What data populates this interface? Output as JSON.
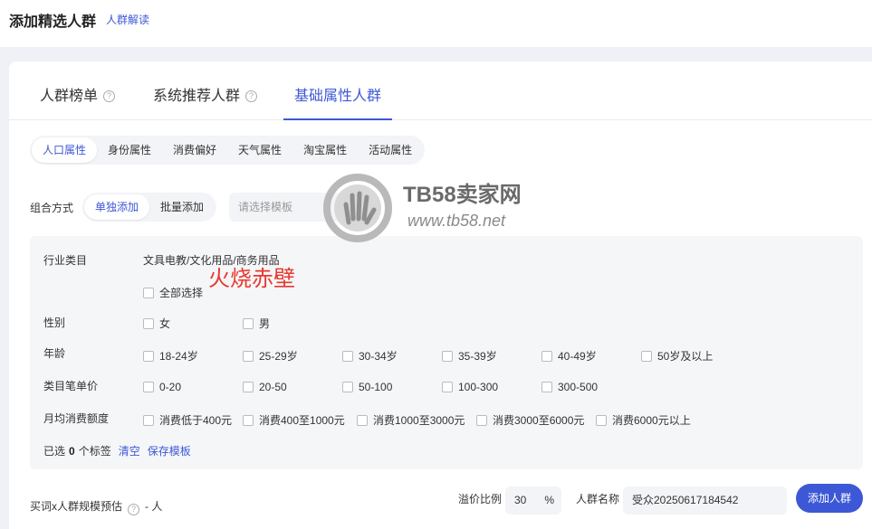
{
  "header": {
    "title": "添加精选人群",
    "link": "人群解读"
  },
  "tabs": [
    {
      "label": "人群榜单",
      "help": "?"
    },
    {
      "label": "系统推荐人群",
      "help": "?"
    },
    {
      "label": "基础属性人群"
    }
  ],
  "subtabs": [
    "人口属性",
    "身份属性",
    "消费偏好",
    "天气属性",
    "淘宝属性",
    "活动属性"
  ],
  "combo": {
    "label": "组合方式",
    "options": [
      "单独添加",
      "批量添加"
    ],
    "template_placeholder": "请选择模板"
  },
  "filters": {
    "industry_label": "行业类目",
    "industry_value": "文具电教/文化用品/商务用品",
    "select_all": "全部选择",
    "gender_label": "性别",
    "gender": [
      "女",
      "男"
    ],
    "age_label": "年龄",
    "ages": [
      "18-24岁",
      "25-29岁",
      "30-34岁",
      "35-39岁",
      "40-49岁",
      "50岁及以上"
    ],
    "price_label": "类目笔单价",
    "prices": [
      "0-20",
      "20-50",
      "50-100",
      "100-300",
      "300-500"
    ],
    "spend_label": "月均消费额度",
    "spends": [
      "消费低于400元",
      "消费400至1000元",
      "消费1000至3000元",
      "消费3000至6000元",
      "消费6000元以上"
    ]
  },
  "selected": {
    "prefix": "已选",
    "count": "0",
    "suffix": "个标签",
    "clear": "清空",
    "save": "保存模板"
  },
  "overlay_text": "火烧赤壁",
  "watermark": {
    "title": "TB58卖家网",
    "url": "www.tb58.net"
  },
  "bottom": {
    "estimate_label": "买词x人群规模预估",
    "estimate_help": "?",
    "estimate_value": "- 人",
    "premium_label": "溢价比例",
    "premium_value": "30",
    "premium_unit": "%",
    "name_label": "人群名称",
    "name_value": "受众20250617184542",
    "add_button": "添加人群"
  },
  "colors": {
    "accent": "#3d58d6",
    "overlay": "#e8382e"
  }
}
